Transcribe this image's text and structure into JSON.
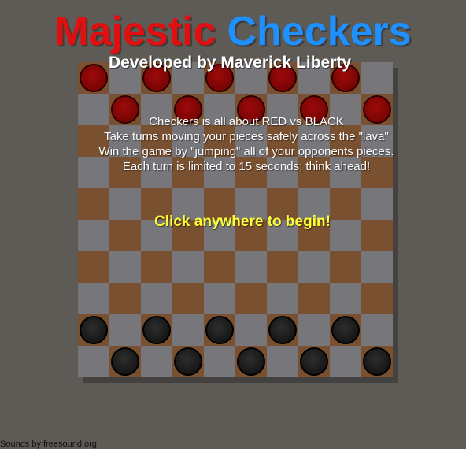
{
  "title": {
    "word1": "Majestic",
    "word2": "Checkers"
  },
  "subtitle": "Developed by Maverick Liberty",
  "instructions": [
    "Checkers is all about RED vs BLACK",
    "Take turns moving your pieces safely across the \"lava\"",
    "Win the game by \"jumping\" all of your opponents pieces.",
    "Each turn is limited to 15 seconds; think ahead!"
  ],
  "start_prompt": "Click anywhere to begin!",
  "credits": "Sounds by freesound.org",
  "colors": {
    "title_red": "#e01010",
    "title_blue": "#1e90ff",
    "prompt_yellow": "#ffff33",
    "light_square": "#77777b",
    "dark_square": "#7a5130",
    "background": "#5e5a55"
  },
  "board": {
    "rows": 10,
    "cols": 10,
    "pieces": {
      "red": [
        [
          0,
          0
        ],
        [
          0,
          2
        ],
        [
          0,
          4
        ],
        [
          0,
          6
        ],
        [
          0,
          8
        ],
        [
          1,
          1
        ],
        [
          1,
          3
        ],
        [
          1,
          5
        ],
        [
          1,
          7
        ],
        [
          1,
          9
        ]
      ],
      "black": [
        [
          8,
          0
        ],
        [
          8,
          2
        ],
        [
          8,
          4
        ],
        [
          8,
          6
        ],
        [
          8,
          8
        ],
        [
          9,
          1
        ],
        [
          9,
          3
        ],
        [
          9,
          5
        ],
        [
          9,
          7
        ],
        [
          9,
          9
        ]
      ]
    }
  }
}
